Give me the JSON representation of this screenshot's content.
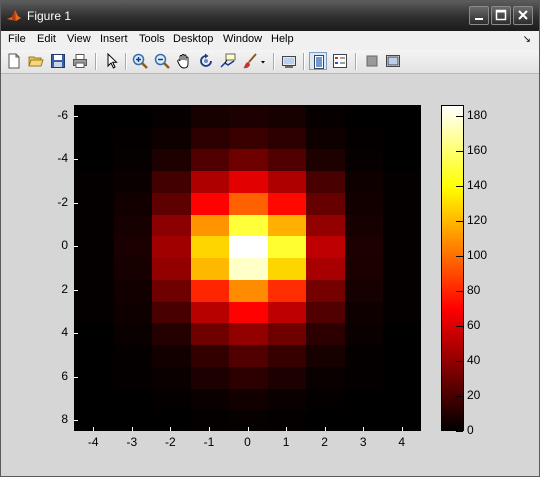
{
  "window": {
    "title": "Figure 1",
    "controls": [
      "minimize",
      "maximize",
      "close"
    ]
  },
  "menubar": {
    "items": [
      "File",
      "Edit",
      "View",
      "Insert",
      "Tools",
      "Desktop",
      "Window",
      "Help"
    ],
    "overflow_arrow": "↘"
  },
  "toolbar": {
    "icons": [
      "new-figure-icon",
      "open-file-icon",
      "save-icon",
      "print-icon",
      "edit-plot-arrow-icon",
      "zoom-in-icon",
      "zoom-out-icon",
      "pan-hand-icon",
      "rotate-3d-icon",
      "data-cursor-icon",
      "brush-icon",
      "brush-dropdown-icon",
      "link-plot-icon",
      "insert-colorbar-icon",
      "insert-legend-icon",
      "hide-plot-tools-icon",
      "show-plot-tools-icon"
    ]
  },
  "chart_data": {
    "type": "heatmap",
    "colormap": "hot",
    "title": "",
    "xlabel": "",
    "ylabel": "",
    "xlim": [
      -4.5,
      4.5
    ],
    "ylim": [
      -6.5,
      8.5
    ],
    "y_reversed": true,
    "xticks": [
      "-4",
      "-3",
      "-2",
      "-1",
      "0",
      "1",
      "2",
      "3",
      "4"
    ],
    "yticks": [
      "-6",
      "-4",
      "-2",
      "0",
      "2",
      "4",
      "6",
      "8"
    ],
    "colorbar": {
      "range": [
        0,
        186
      ],
      "ticks": [
        "0",
        "20",
        "40",
        "60",
        "80",
        "100",
        "120",
        "140",
        "160",
        "180"
      ]
    },
    "x_centers": [
      -4,
      -3,
      -2,
      -1,
      0,
      1,
      2,
      3,
      4
    ],
    "y_centers": [
      -6,
      -5,
      -4,
      -3,
      -2,
      -1,
      0,
      1,
      2,
      3,
      4,
      5,
      6,
      7,
      8
    ],
    "values": [
      [
        0,
        0,
        2,
        6,
        8,
        6,
        2,
        0,
        0
      ],
      [
        0,
        1,
        4,
        12,
        16,
        12,
        4,
        1,
        0
      ],
      [
        0,
        2,
        8,
        22,
        30,
        22,
        8,
        2,
        0
      ],
      [
        1,
        3,
        18,
        48,
        62,
        48,
        20,
        4,
        1
      ],
      [
        1,
        5,
        26,
        70,
        96,
        72,
        28,
        5,
        1
      ],
      [
        1,
        6,
        38,
        110,
        150,
        118,
        40,
        6,
        1
      ],
      [
        1,
        7,
        44,
        128,
        186,
        148,
        52,
        8,
        1
      ],
      [
        1,
        6,
        40,
        120,
        176,
        128,
        46,
        7,
        1
      ],
      [
        1,
        5,
        30,
        80,
        108,
        82,
        32,
        6,
        1
      ],
      [
        1,
        4,
        20,
        50,
        70,
        52,
        22,
        4,
        1
      ],
      [
        0,
        3,
        10,
        30,
        40,
        30,
        12,
        3,
        0
      ],
      [
        0,
        1,
        5,
        14,
        22,
        15,
        6,
        1,
        0
      ],
      [
        0,
        1,
        3,
        8,
        12,
        8,
        3,
        1,
        0
      ],
      [
        0,
        0,
        1,
        3,
        5,
        3,
        1,
        0,
        0
      ],
      [
        0,
        0,
        0,
        1,
        2,
        1,
        0,
        0,
        0
      ]
    ]
  }
}
